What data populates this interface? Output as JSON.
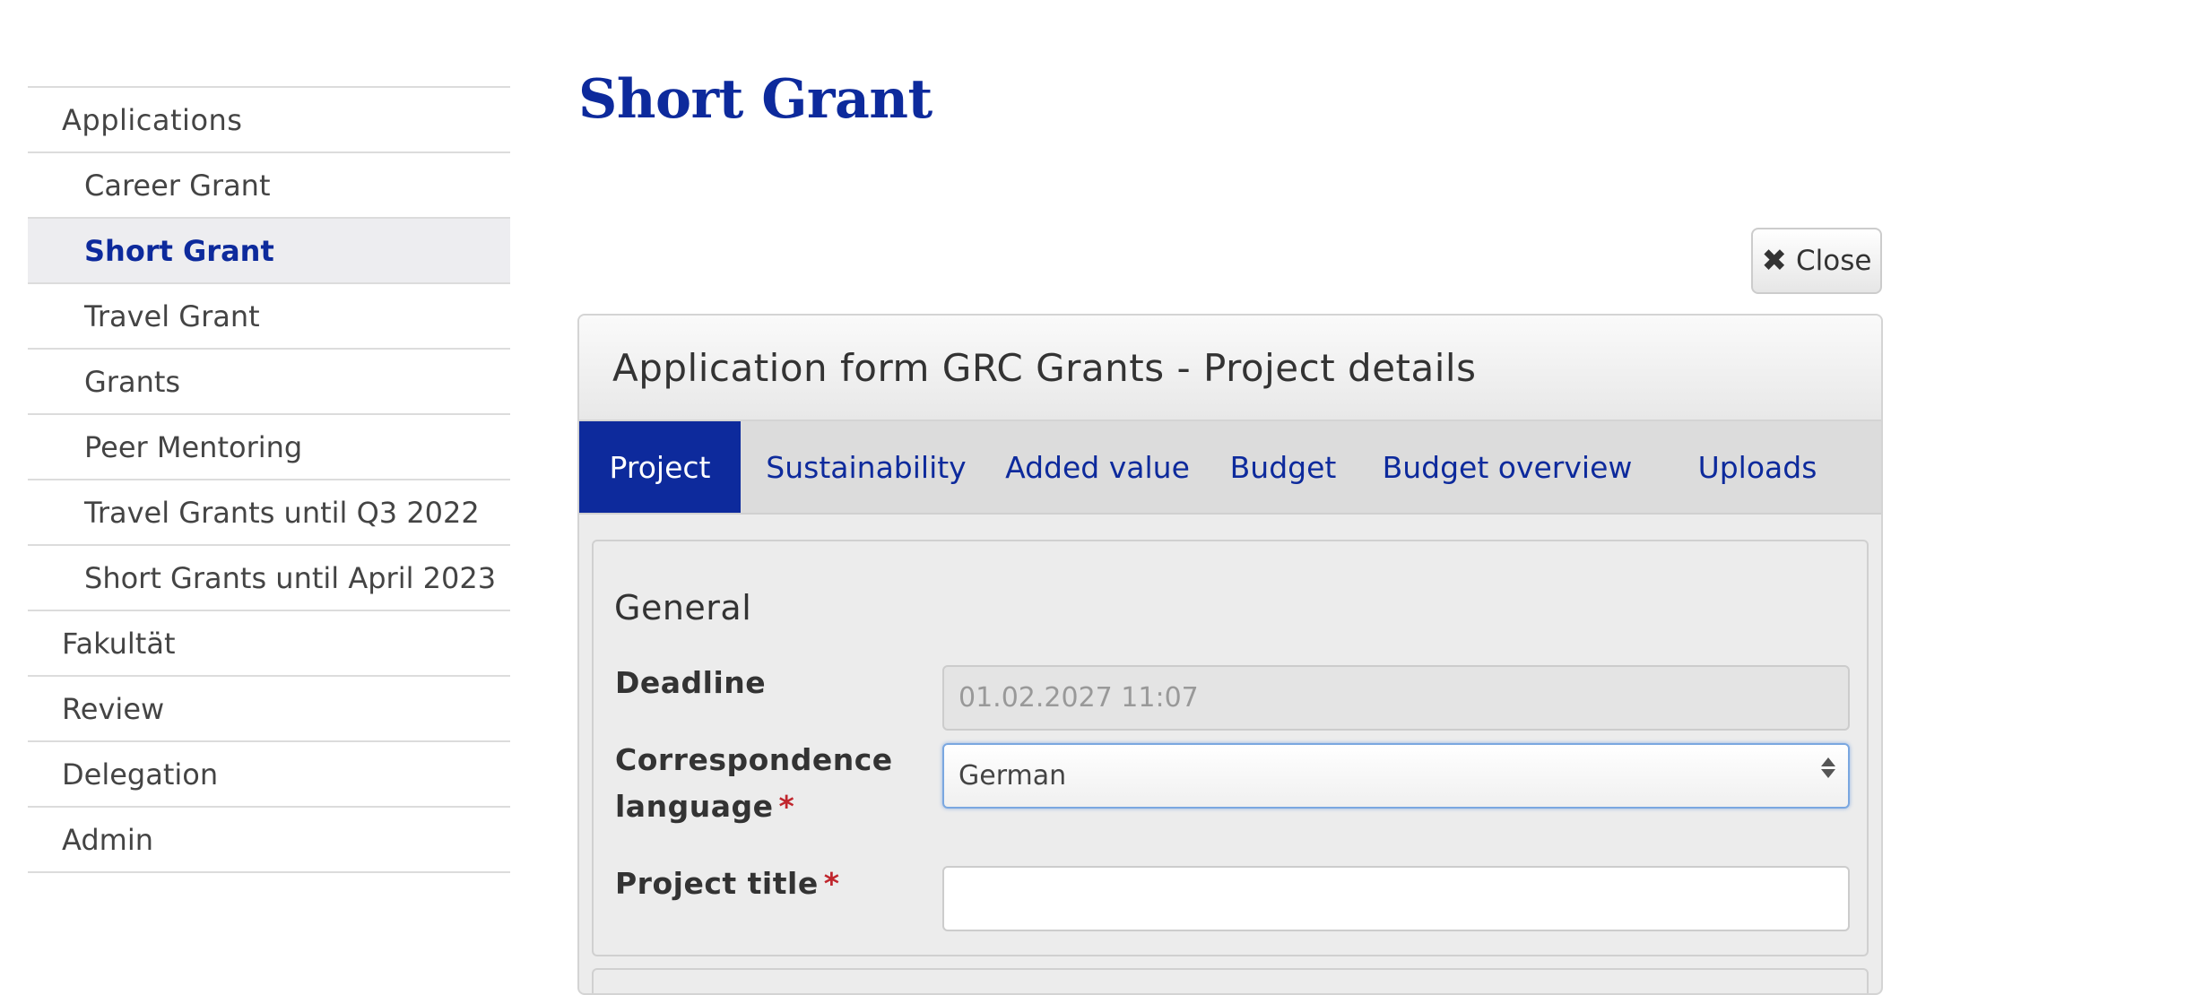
{
  "page_title": "Short Grant",
  "sidebar": {
    "items": [
      {
        "label": "Applications"
      },
      {
        "label": "Career Grant"
      },
      {
        "label": "Short Grant"
      },
      {
        "label": "Travel Grant"
      },
      {
        "label": "Grants"
      },
      {
        "label": "Peer Mentoring"
      },
      {
        "label": "Travel Grants until Q3 2022"
      },
      {
        "label": "Short Grants until April 2023"
      },
      {
        "label": "Fakultät"
      },
      {
        "label": "Review"
      },
      {
        "label": "Delegation"
      },
      {
        "label": "Admin"
      }
    ]
  },
  "close_button": {
    "label": "Close",
    "icon": "close-icon"
  },
  "panel": {
    "heading": "Application form GRC Grants - Project details",
    "tabs": [
      {
        "label": "Project"
      },
      {
        "label": "Sustainability"
      },
      {
        "label": "Added value"
      },
      {
        "label": "Budget"
      },
      {
        "label": "Budget overview"
      },
      {
        "label": "Uploads"
      }
    ],
    "fieldset": {
      "legend": "General",
      "fields": [
        {
          "label": "Deadline",
          "value": "01.02.2027 11:07"
        },
        {
          "label_line1": "Correspondence",
          "label_line2": "language",
          "required_mark": "*",
          "value": "German"
        },
        {
          "label": "Project title",
          "required_mark": "*",
          "value": ""
        }
      ]
    }
  },
  "colors": {
    "accent": "#0d2a9c",
    "required": "#c0262d"
  }
}
